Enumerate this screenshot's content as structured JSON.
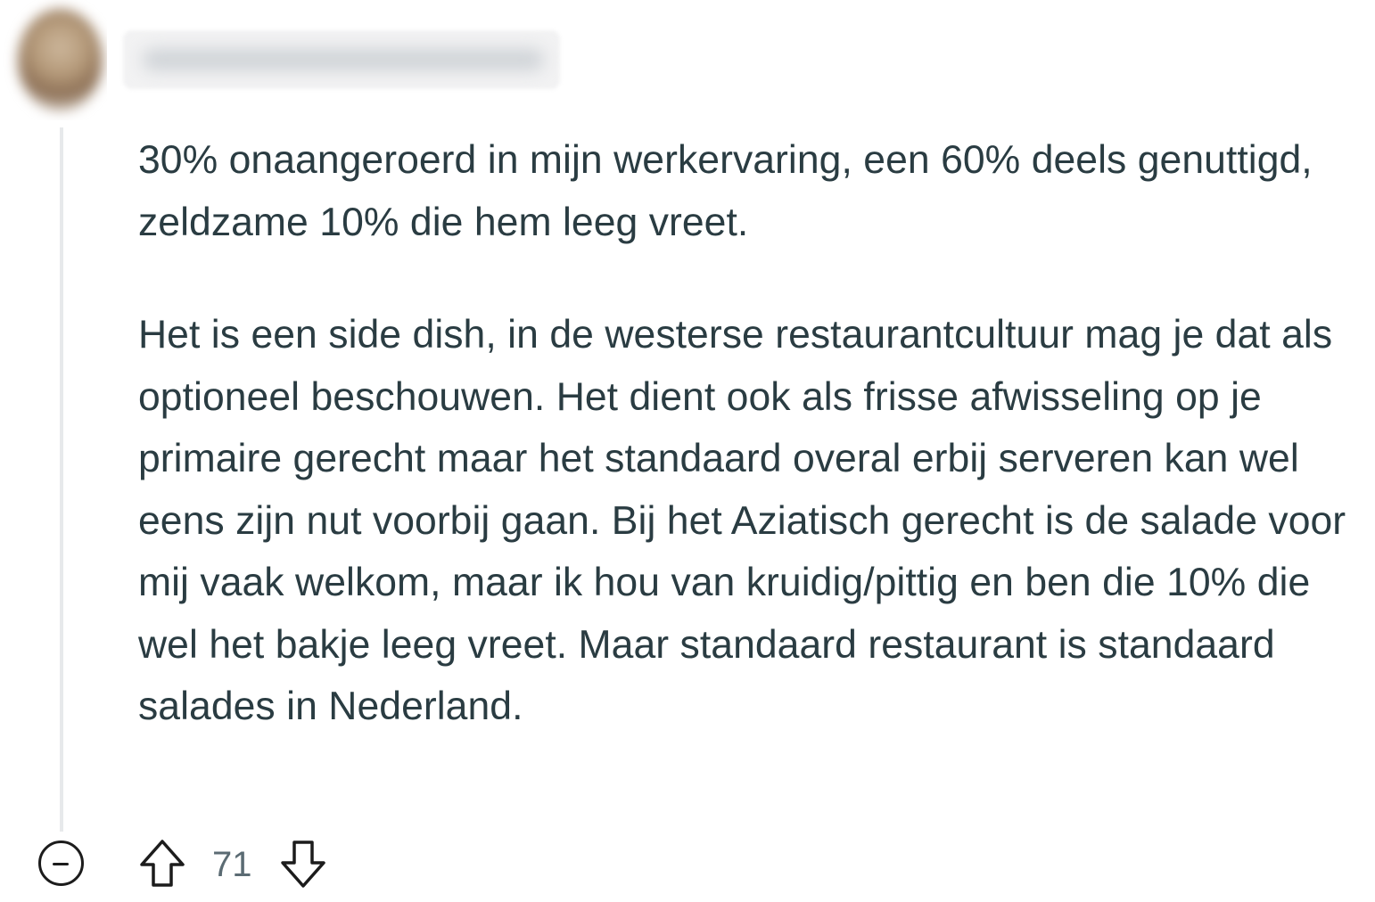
{
  "comment": {
    "paragraphs": [
      "30% onaangeroerd in mijn werkervaring, een 60% deels genuttigd, zeldzame 10% die hem leeg vreet.",
      "Het is een side dish, in de westerse restaurantcultuur mag je dat als optioneel beschouwen. Het dient ook als frisse afwisseling op je primaire gerecht maar het standaard overal erbij serveren kan wel eens zijn nut voorbij gaan. Bij het Aziatisch gerecht is de salade voor mij vaak welkom, maar ik hou van kruidig/pittig en ben die 10% die wel het bakje leeg vreet. Maar standaard restaurant is standaard salades in Nederland."
    ],
    "vote_count": "71"
  },
  "icons": {
    "collapse": "minus-circle-icon",
    "upvote": "arrow-up-outline-icon",
    "downvote": "arrow-down-outline-icon"
  },
  "colors": {
    "body_text": "#2a3c42",
    "vote_text": "#5b6b73",
    "icon": "#1c1c1c",
    "thread_line": "#e7e9eb"
  }
}
